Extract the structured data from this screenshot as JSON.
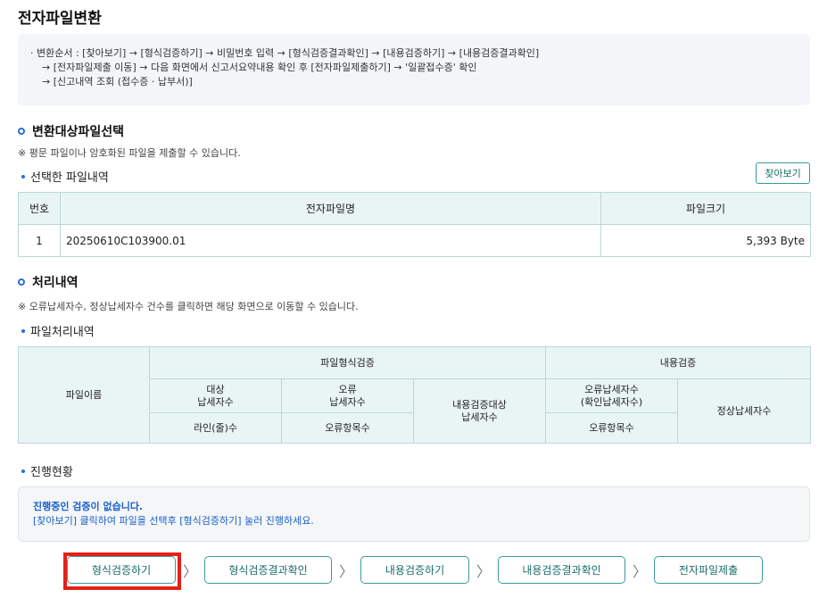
{
  "page_title": "전자파일변환",
  "guide": {
    "line1": "· 변환순서 : [찾아보기] → [형식검증하기] → 비밀번호 입력 → [형식검증결과확인] → [내용검증하기] → [내용검증결과확인]",
    "line2": "→ [전자파일제출 이동] → 다음 화면에서 신고서요약내용 확인 후 [전자파일제출하기] → '일괄접수증' 확인",
    "line3": "→ [신고내역 조회 (접수증 · 납부서)]"
  },
  "select_section": {
    "title": "변환대상파일선택",
    "note": "※ 평문 파일이나 암호화된 파일을 제출할 수 있습니다.",
    "sub_title": "선택한 파일내역",
    "find_button": "찾아보기",
    "table": {
      "headers": [
        "번호",
        "전자파일명",
        "파일크기"
      ],
      "rows": [
        {
          "no": "1",
          "name": "20250610C103900.01",
          "size": "5,393 Byte"
        }
      ]
    }
  },
  "process_section": {
    "title": "처리내역",
    "note": "※ 오류납세자수, 정상납세자수 건수를 클릭하면 해당 화면으로 이동할 수 있습니다.",
    "sub_title": "파일처리내역",
    "table": {
      "file_name": "파일이름",
      "format_check": "파일형식검증",
      "content_check": "내용검증",
      "target_count": "대상\n납세자수",
      "error_count": "오류\n납세자수",
      "content_target": "내용검증대상\n납세자수",
      "error_taxpayers": "오류납세자수\n(확인납세자수)",
      "normal_taxpayers": "정상납세자수",
      "line_count": "라인(줄)수",
      "error_items": "오류항목수",
      "content_error_items": "오류항목수"
    }
  },
  "progress": {
    "sub_title": "진행현황",
    "title": "진행중인 검증이 없습니다.",
    "desc": "[찾아보기] 클릭하여 파일을 선택후 [형식검증하기] 눌러 진행하세요."
  },
  "steps": {
    "format_check": "형식검증하기",
    "format_result": "형식검증결과확인",
    "content_check": "내용검증하기",
    "content_result": "내용검증결과확인",
    "submit": "전자파일제출",
    "arrow": "〉"
  },
  "colors": {
    "accent": "#2a6fd6",
    "teal_border": "#3a9a98",
    "header_bg": "#e9f5f4",
    "highlight": "#e32119"
  }
}
